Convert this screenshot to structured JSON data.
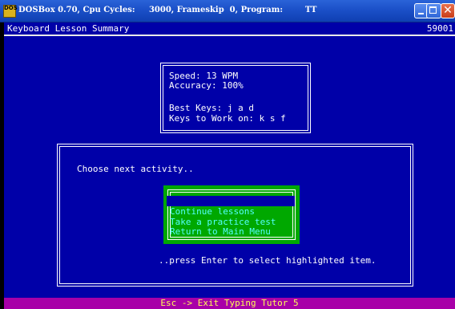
{
  "window": {
    "app_icon_text": "DOS",
    "title": "DOSBox 0.70, Cpu Cycles:     3000, Frameskip  0, Program:        TT"
  },
  "dos": {
    "header_title": "Keyboard Lesson Summary",
    "header_number": "59001",
    "stats": {
      "speed": "Speed: 13 WPM",
      "accuracy": "Accuracy: 100%",
      "best_keys": "Best Keys: j a d",
      "keys_to_work_on": "Keys to Work on: k s f"
    },
    "prompt": "Choose next activity..",
    "menu": [
      {
        "label": "Continue lessons",
        "selected": true
      },
      {
        "label": "Take a practice test",
        "selected": false
      },
      {
        "label": "Return to Main Menu",
        "selected": false
      }
    ],
    "hint": "..press Enter to select highlighted item.",
    "footer": "Esc -> Exit Typing Tutor 5"
  },
  "colors": {
    "screen_bg": "#0000a8",
    "footer_bg": "#a800a8",
    "menu_bg": "#00a800"
  }
}
